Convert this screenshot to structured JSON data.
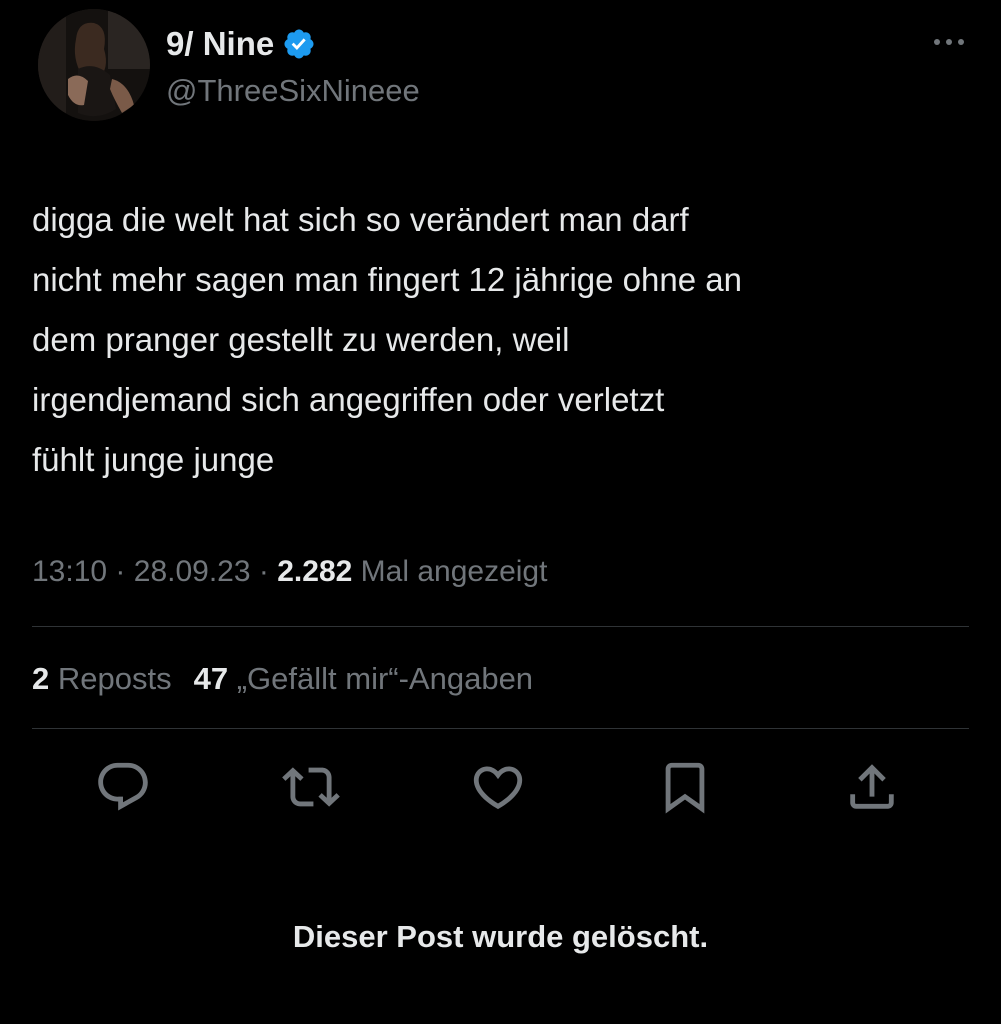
{
  "author": {
    "display_name": "9/ Nine",
    "handle": "@ThreeSixNineee",
    "verified": true,
    "verified_color": "#1d9bf0"
  },
  "tweet": {
    "lines": [
      "digga die welt hat sich so verändert man darf",
      "nicht mehr sagen man fingert 12 jährige ohne an",
      "dem pranger gestellt zu werden, weil",
      "irgendjemand sich angegriffen oder verletzt",
      "fühlt junge junge"
    ]
  },
  "meta": {
    "time": "13:10",
    "separator": "·",
    "date": "28.09.23",
    "views_count": "2.282",
    "views_label": "Mal angezeigt"
  },
  "stats": {
    "reposts_count": "2",
    "reposts_label": "Reposts",
    "likes_count": "47",
    "likes_label": "„Gefällt mir“-Angaben"
  },
  "actions": {
    "icons": [
      "reply-icon",
      "repost-icon",
      "like-icon",
      "bookmark-icon",
      "share-icon"
    ]
  },
  "notice": {
    "text": "Dieser Post wurde gelöscht."
  },
  "colors": {
    "background": "#000000",
    "text_primary": "#e7e9ea",
    "text_secondary": "#71767b",
    "divider": "#2f3336"
  }
}
